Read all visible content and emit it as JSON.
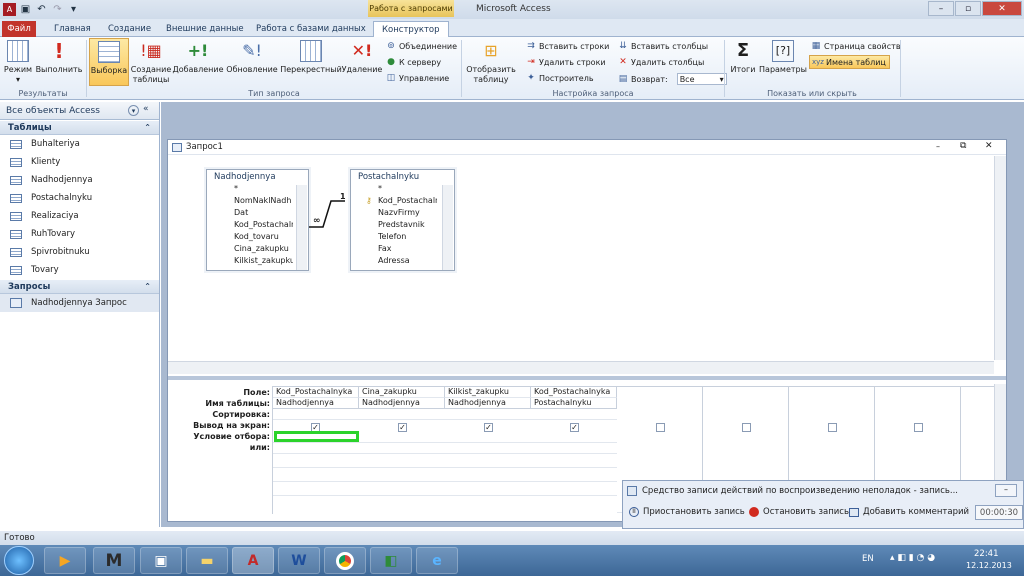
{
  "window": {
    "title": "Microsoft Access",
    "context_tab": "Работа с запросами"
  },
  "tabs": [
    "Файл",
    "Главная",
    "Создание",
    "Внешние данные",
    "Работа с базами данных",
    "Конструктор"
  ],
  "ribbon": {
    "results": {
      "label": "Результаты",
      "mode": "Режим",
      "run": "Выполнить"
    },
    "query_type": {
      "label": "Тип запроса",
      "select": "Выборка",
      "make_table": "Создание таблицы",
      "append": "Добавление",
      "update": "Обновление",
      "crosstab": "Перекрестный",
      "delete": "Удаление",
      "union": "Объединение",
      "passthrough": "К серверу",
      "ddl": "Управление"
    },
    "setup": {
      "label": "Настройка запроса",
      "show_table": "Отобразить таблицу",
      "insert_rows": "Вставить строки",
      "delete_rows": "Удалить строки",
      "builder": "Построитель",
      "insert_cols": "Вставить столбцы",
      "delete_cols": "Удалить столбцы",
      "return_label": "Возврат:",
      "return_value": "Все"
    },
    "show_hide": {
      "label": "Показать или скрыть",
      "totals": "Итоги",
      "params": "Параметры",
      "props": "Страница свойств",
      "table_names": "Имена таблиц"
    }
  },
  "nav": {
    "header": "Все объекты Access",
    "tables_group": "Таблицы",
    "tables": [
      "Buhalteriya",
      "Klienty",
      "Nadhodjennya",
      "Postachalnyku",
      "Realizaciya",
      "RuhTovary",
      "Spivrobitnuku",
      "Tovary"
    ],
    "queries_group": "Запросы",
    "queries": [
      "Nadhodjennya Запрос"
    ]
  },
  "query_window": {
    "title": "Запрос1",
    "table1": {
      "name": "Nadhodjennya",
      "fields": [
        "*",
        "NomNaklNadh",
        "Dat",
        "Kod_Postachaln",
        "Kod_tovaru",
        "Cina_zakupku",
        "Kilkist_zakupku"
      ]
    },
    "table2": {
      "name": "Postachalnyku",
      "fields": [
        "*",
        "Kod_Postachaln",
        "NazvFirmy",
        "Predstavnik",
        "Telefon",
        "Fax",
        "Adressa"
      ]
    },
    "join": {
      "one": "1",
      "many": "∞"
    }
  },
  "grid": {
    "row_labels": [
      "Поле:",
      "Имя таблицы:",
      "Сортировка:",
      "Вывод на экран:",
      "Условие отбора:",
      "или:"
    ],
    "columns": [
      {
        "field": "Kod_Postachalnyka",
        "table": "Nadhodjennya",
        "show": "✓"
      },
      {
        "field": "Cina_zakupku",
        "table": "Nadhodjennya",
        "show": "✓"
      },
      {
        "field": "Kilkist_zakupku",
        "table": "Nadhodjennya",
        "show": "✓"
      },
      {
        "field": "Kod_Postachalnyka",
        "table": "Postachalnyku",
        "show": "✓"
      },
      {
        "field": "",
        "table": "",
        "show": ""
      },
      {
        "field": "",
        "table": "",
        "show": ""
      },
      {
        "field": "",
        "table": "",
        "show": ""
      },
      {
        "field": "",
        "table": "",
        "show": ""
      }
    ]
  },
  "status": "Готово",
  "psr": {
    "title": "Средство записи действий по воспроизведению неполадок - запись...",
    "pause": "Приостановить запись",
    "stop": "Остановить запись",
    "comment": "Добавить комментарий",
    "timer": "00:00:30"
  },
  "taskbar": {
    "lang": "EN",
    "time": "22:41",
    "date": "12.12.2013"
  }
}
